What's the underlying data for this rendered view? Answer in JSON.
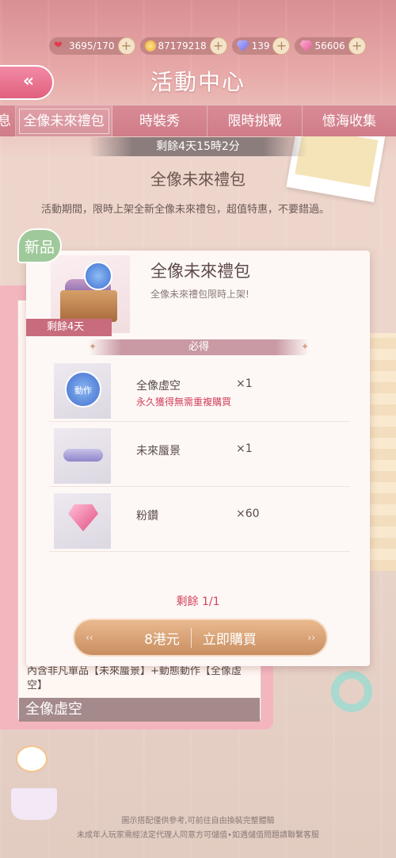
{
  "resources": [
    {
      "icon": "heart-icon",
      "value": "3695/170"
    },
    {
      "icon": "gold-coin-icon",
      "value": "87179218"
    },
    {
      "icon": "blue-diamond-icon",
      "value": "139"
    },
    {
      "icon": "pink-diamond-icon",
      "value": "56606"
    }
  ],
  "header": {
    "back_label": "«",
    "title": "活動中心"
  },
  "tabs": [
    {
      "label": "息"
    },
    {
      "label": "全像未來禮包",
      "active": true
    },
    {
      "label": "時裝秀"
    },
    {
      "label": "限時挑戰"
    },
    {
      "label": "憶海收集"
    }
  ],
  "timer": "剩餘4天15時2分",
  "section_title": "全像未來禮包",
  "description": "活動期間，限時上架全新全像未來禮包，超值特惠，不要錯過。",
  "underlying": {
    "text": "內含非凡單品【未來蜃景】+動態動作【全像虛空】",
    "bar_label": "全像虛空"
  },
  "popup": {
    "new_badge": "新品",
    "remain_tag": "剩餘4天",
    "title": "全像未來禮包",
    "subtitle": "全像未來禮包限時上架!",
    "must_label": "必得",
    "items": [
      {
        "name": "全像虛空",
        "qty": "×1",
        "note": "永久獲得無需重複購買",
        "thumb_text": "動作"
      },
      {
        "name": "未來蜃景",
        "qty": "×1",
        "note": ""
      },
      {
        "name": "粉鑽",
        "qty": "×60",
        "note": ""
      }
    ],
    "remain_count": "剩餘 1/1",
    "price": "8港元",
    "buy_label": "立即購買"
  },
  "footer": {
    "line1": "圖示搭配僅供參考,可前往自由換裝完整體驗",
    "line2": "未成年人玩家需經法定代理人同意方可儲值•如遇儲值問題請聯繫客服"
  },
  "colors": {
    "accent_pink": "#e0607f",
    "tab_bg": "#d98b95",
    "buy_button": "#c98f62",
    "warning_red": "#d3425c",
    "new_badge_green": "#9fc99a"
  }
}
